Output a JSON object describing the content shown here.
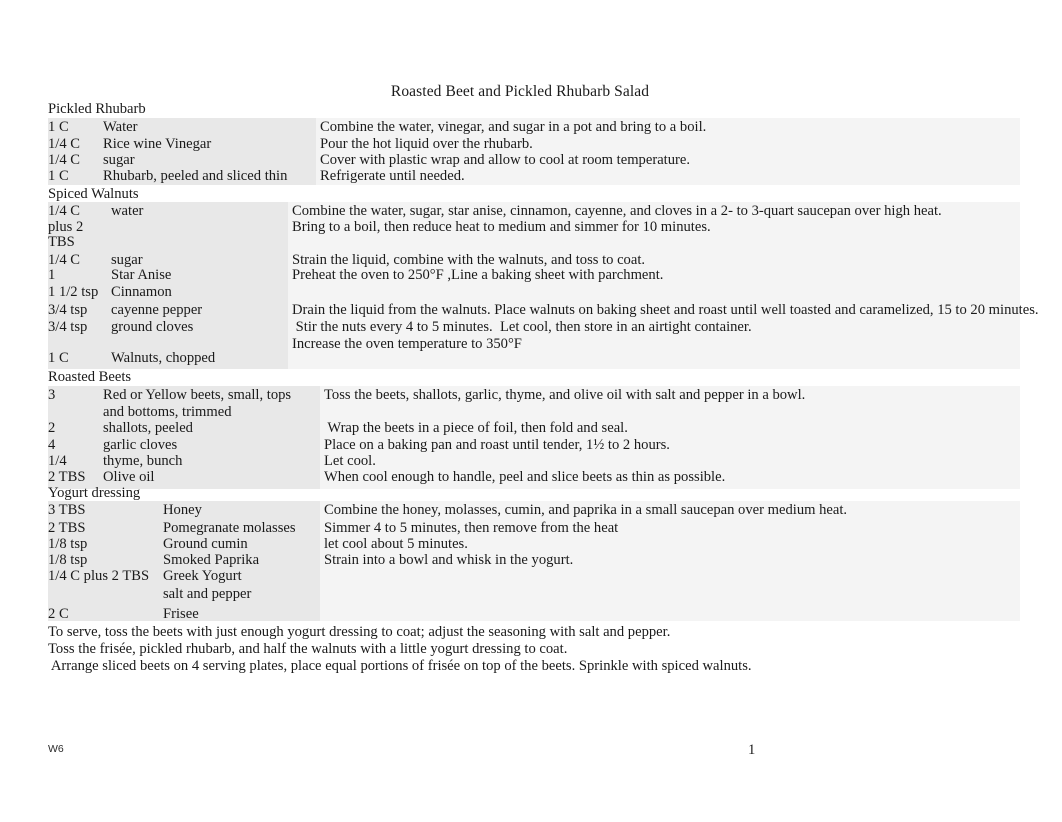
{
  "document": {
    "title": "Roasted Beet and Pickled Rhubarb Salad",
    "footer_left": "W6",
    "page_number": "1",
    "background_color": "#ffffff",
    "text_color": "#1a1a1a",
    "table_shade_color": "#e8e8e8"
  },
  "sections": [
    {
      "heading": "Pickled Rhubarb",
      "ingredients": [
        {
          "qty": "1 C",
          "item": "Water"
        },
        {
          "qty": "1/4 C",
          "item": "Rice wine Vinegar"
        },
        {
          "qty": "1/4 C",
          "item": "sugar"
        },
        {
          "qty": "1 C",
          "item": "Rhubarb, peeled and sliced thin"
        }
      ],
      "instructions": [
        "Combine the water, vinegar, and sugar in a pot and bring to a boil.",
        "Pour the hot liquid over the rhubarb.",
        "Cover with plastic wrap and allow to cool at room temperature.",
        "Refrigerate until needed."
      ]
    },
    {
      "heading": "Spiced Walnuts",
      "ingredients": [
        {
          "qty": "1/4 C",
          "item": "water"
        },
        {
          "qty": "plus 2",
          "item": ""
        },
        {
          "qty": "TBS",
          "item": ""
        },
        {
          "qty": "1/4 C",
          "item": "sugar"
        },
        {
          "qty": "1",
          "item": "Star Anise"
        },
        {
          "qty": "1 1/2 tsp",
          "item": "Cinnamon"
        },
        {
          "qty": "3/4 tsp",
          "item": "cayenne pepper"
        },
        {
          "qty": "3/4 tsp",
          "item": "ground cloves"
        },
        {
          "qty": "1 C",
          "item": "Walnuts, chopped"
        }
      ],
      "instructions": [
        "Combine the water, sugar, star anise, cinnamon, cayenne, and cloves in a 2- to 3-quart saucepan over high heat.",
        "Bring to a boil, then reduce heat to medium and simmer for 10 minutes.",
        "Strain the liquid, combine with the walnuts, and toss to coat.",
        "Preheat the oven to 250°F ,Line a baking sheet with parchment.",
        "Drain the liquid from the walnuts. Place walnuts on baking sheet and roast until well toasted and caramelized, 15 to 20 minutes.",
        " Stir the nuts every 4 to 5 minutes.  Let cool, then store in an airtight container.",
        "Increase the oven temperature to 350°F"
      ]
    },
    {
      "heading": "Roasted Beets",
      "ingredients": [
        {
          "qty": "3",
          "item": "Red or Yellow beets, small, tops and bottoms, trimmed"
        },
        {
          "qty": "2",
          "item": "shallots, peeled"
        },
        {
          "qty": "4",
          "item": "garlic cloves"
        },
        {
          "qty": "1/4",
          "item": "thyme, bunch"
        },
        {
          "qty": "2 TBS",
          "item": "Olive oil"
        }
      ],
      "instructions": [
        "Toss the beets, shallots, garlic, thyme, and olive oil with salt and pepper in a bowl.",
        " Wrap the beets in a piece of foil, then fold and seal.",
        "Place on a baking pan and roast until tender, 1½ to 2 hours.",
        "Let cool.",
        "When cool enough to handle, peel and slice beets as thin as possible."
      ]
    },
    {
      "heading": "Yogurt dressing",
      "ingredients": [
        {
          "qty": "3 TBS",
          "item": "Honey"
        },
        {
          "qty": "2 TBS",
          "item": "Pomegranate molasses"
        },
        {
          "qty": "1/8 tsp",
          "item": "Ground cumin"
        },
        {
          "qty": "1/8 tsp",
          "item": "Smoked Paprika"
        },
        {
          "qty": "1/4 C plus 2 TBS",
          "item": "Greek Yogurt"
        },
        {
          "qty": "",
          "item": "salt and pepper"
        },
        {
          "qty": "2 C",
          "item": "Frisee"
        }
      ],
      "instructions": [
        "Combine the honey, molasses, cumin, and paprika in a small saucepan over medium heat.",
        "Simmer 4 to 5 minutes, then remove from the heat",
        "let cool about 5 minutes.",
        "Strain into a bowl and whisk in the yogurt."
      ]
    }
  ],
  "closing_steps": [
    "To serve, toss the beets with just enough yogurt dressing to coat; adjust the seasoning with salt and pepper.",
    "Toss the frisée, pickled rhubarb, and half the walnuts with a little yogurt dressing to coat.",
    " Arrange sliced beets on 4 serving plates, place equal portions of frisée on top of the beets. Sprinkle with spiced walnuts."
  ]
}
